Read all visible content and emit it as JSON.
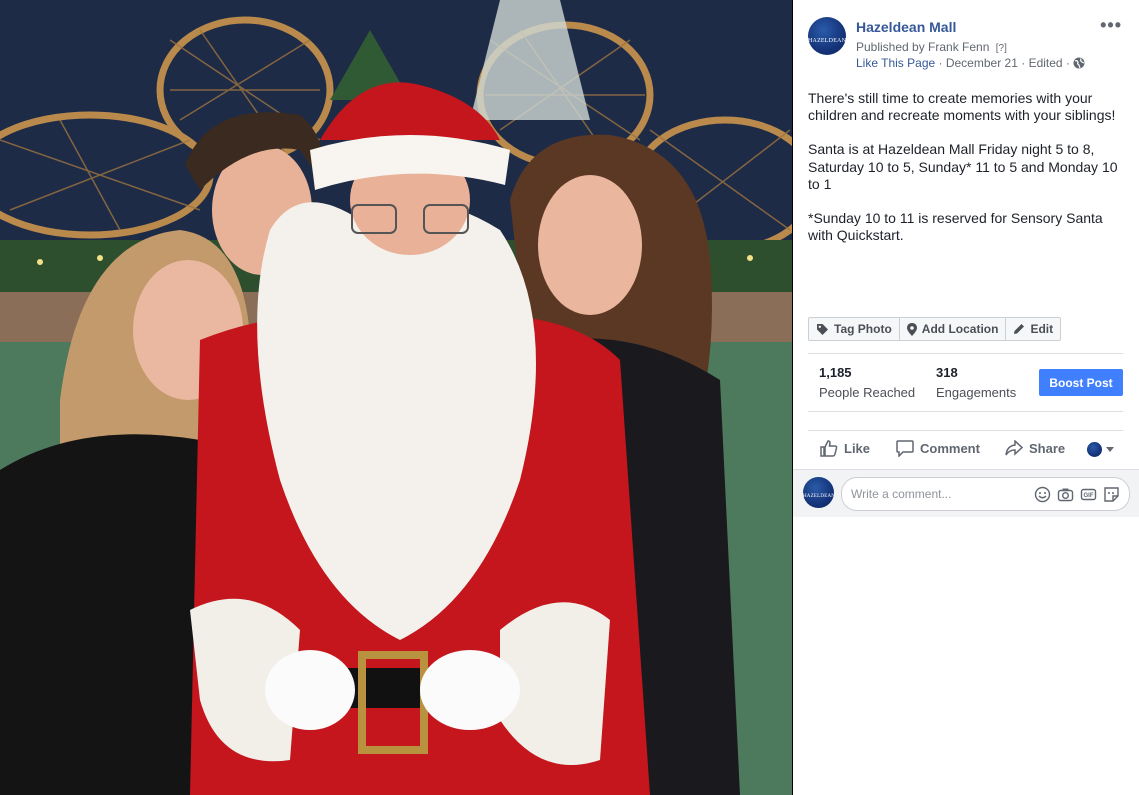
{
  "post": {
    "page_name": "Hazeldean Mall",
    "avatar_text": "HAZELDEAN",
    "published_by": "Published by Frank Fenn",
    "published_help": "[?]",
    "like_page": "Like This Page",
    "meta_sep": " · ",
    "date": "December 21",
    "edited": "Edited",
    "audience_icon": "globe-icon",
    "more_icon": "more-options-icon",
    "more_glyph": "•••",
    "paragraphs": [
      "There's still time to create memories with your children and recreate moments with your siblings!",
      "Santa is at Hazeldean Mall Friday night 5 to 8, Saturday 10 to 5, Sunday* 11 to 5 and Monday 10 to 1",
      "*Sunday 10 to 11 is reserved for Sensory Santa with Quickstart."
    ]
  },
  "photo_actions": [
    {
      "label": "Tag Photo",
      "icon": "tag-icon"
    },
    {
      "label": "Add Location",
      "icon": "location-pin-icon"
    },
    {
      "label": "Edit",
      "icon": "pencil-icon"
    }
  ],
  "insights": {
    "reached_value": "1,185",
    "reached_label": "People Reached",
    "engagements_value": "318",
    "engagements_label": "Engagements",
    "boost_label": "Boost Post"
  },
  "reactions": {
    "like": "Like",
    "comment": "Comment",
    "share": "Share",
    "audience_selector_icon": "chevron-down-icon"
  },
  "comment": {
    "placeholder": "Write a comment...",
    "icons": [
      "emoji-icon",
      "camera-icon",
      "gif-icon",
      "sticker-icon"
    ]
  },
  "colors": {
    "link": "#365899",
    "boost": "#4080ff",
    "text": "#1d2129"
  }
}
